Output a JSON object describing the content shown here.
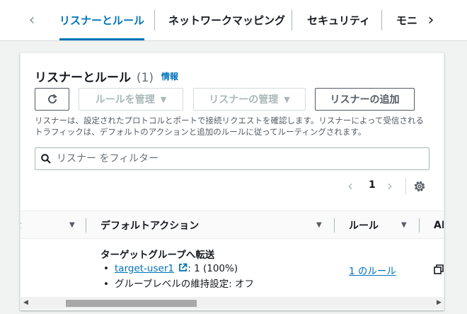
{
  "tabs": {
    "items": [
      {
        "label": "リスナーとルール",
        "active": true
      },
      {
        "label": "ネットワークマッピング",
        "active": false
      },
      {
        "label": "セキュリティ",
        "active": false
      },
      {
        "label": "モニ",
        "active": false
      }
    ],
    "prev_icon": "chevron-left-icon",
    "next_icon": "chevron-right-icon"
  },
  "panel": {
    "title": "リスナーとルール",
    "count": "(1)",
    "info_link": "情報",
    "buttons": {
      "refresh_icon": "refresh-icon",
      "manage_rules": "ルールを管理",
      "manage_listener": "リスナーの管理",
      "add_listener": "リスナーの追加"
    },
    "description": "リスナーは、設定されたプロトコルとポートで接続リクエストを確認します。リスナーによって受信されるトラフィックは、デフォルトのアクションと追加のルールに従ってルーティングされます。",
    "filter_placeholder": "リスナー をフィルター",
    "pagination": {
      "current_page": "1"
    }
  },
  "table": {
    "columns": [
      {
        "label": "t"
      },
      {
        "label": "デフォルトアクション"
      },
      {
        "label": "ルール"
      },
      {
        "label": "AR"
      }
    ],
    "rows": [
      {
        "default_action_title": "ターゲットグループへ転送",
        "target_group_link": "target-user1",
        "target_group_weight": ": 1 (100%)",
        "stickiness": "グループレベルの維持設定: オフ",
        "rules_link": "1 のルール"
      }
    ]
  },
  "colors": {
    "accent": "#0073bb",
    "text": "#16191f",
    "muted": "#545b64",
    "disabled": "#aab7b8"
  }
}
